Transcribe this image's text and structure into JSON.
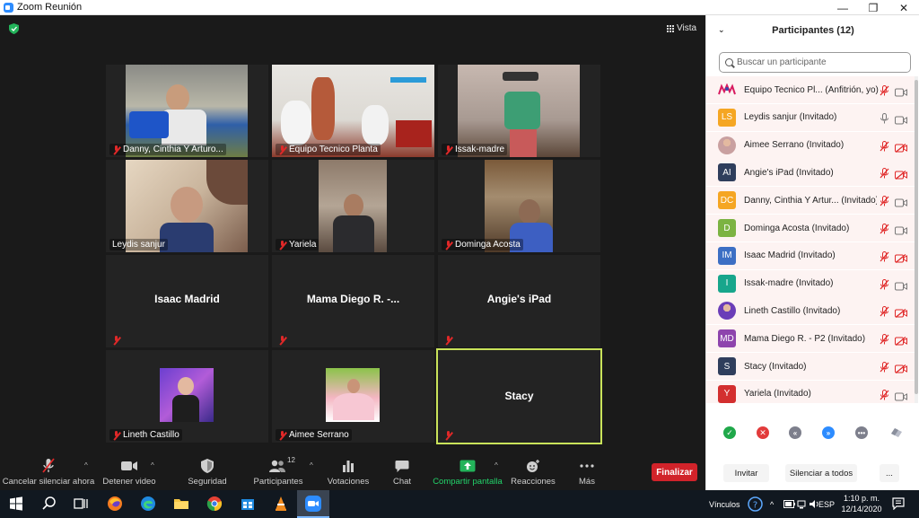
{
  "window": {
    "title": "Zoom Reunión",
    "minimize": "—",
    "maximize": "❐",
    "close": "✕"
  },
  "meeting": {
    "view_label": "Vista",
    "tiles": [
      {
        "name": "Danny, Cinthia Y Arturo...",
        "muted": true,
        "video": true
      },
      {
        "name": "Equipo Tecnico Planta",
        "muted": true,
        "video": true
      },
      {
        "name": "Issak-madre",
        "muted": true,
        "video": true
      },
      {
        "name": "Leydis sanjur",
        "muted": false,
        "video": true
      },
      {
        "name": "Yariela",
        "muted": true,
        "video": true
      },
      {
        "name": "Dominga Acosta",
        "muted": true,
        "video": true
      },
      {
        "name": "Isaac Madrid",
        "muted": true,
        "video": false
      },
      {
        "name": "Mama Diego R. -...",
        "muted": true,
        "video": false
      },
      {
        "name": "Angie's iPad",
        "muted": true,
        "video": false
      },
      {
        "name": "Lineth Castillo",
        "muted": true,
        "video": true
      },
      {
        "name": "Aimee Serrano",
        "muted": true,
        "video": true
      },
      {
        "name": "Stacy",
        "muted": true,
        "video": false,
        "active_speaker": true
      }
    ]
  },
  "toolbar": {
    "unmute": "Cancelar silenciar ahora",
    "stop_video": "Detener video",
    "security": "Seguridad",
    "participants": "Participantes",
    "participants_count": "12",
    "polls": "Votaciones",
    "chat": "Chat",
    "share": "Compartir pantalla",
    "reactions": "Reacciones",
    "more": "Más",
    "end": "Finalizar"
  },
  "panel": {
    "title": "Participantes (12)",
    "search_placeholder": "Buscar un participante",
    "participants": [
      {
        "initials": "",
        "name": "Equipo Tecnico Pl... (Anfitrión, yo)",
        "color": "#ffffff",
        "mic": "muted",
        "cam": "on",
        "photo": "logo"
      },
      {
        "initials": "LS",
        "name": "Leydis sanjur (Invitado)",
        "color": "#f5a623",
        "mic": "on",
        "cam": "on"
      },
      {
        "initials": "",
        "name": "Aimee Serrano (Invitado)",
        "color": "#c9a0a0",
        "mic": "muted",
        "cam": "off",
        "photo": "photo"
      },
      {
        "initials": "AI",
        "name": "Angie's iPad (Invitado)",
        "color": "#2f3e5c",
        "mic": "muted",
        "cam": "off"
      },
      {
        "initials": "DC",
        "name": "Danny, Cinthia Y Artur... (Invitado)",
        "color": "#f5a623",
        "mic": "muted",
        "cam": "on"
      },
      {
        "initials": "D",
        "name": "Dominga Acosta (Invitado)",
        "color": "#7cb342",
        "mic": "muted",
        "cam": "on"
      },
      {
        "initials": "IM",
        "name": "Isaac Madrid (Invitado)",
        "color": "#3c6fc4",
        "mic": "muted",
        "cam": "off"
      },
      {
        "initials": "I",
        "name": "Issak-madre (Invitado)",
        "color": "#17a68c",
        "mic": "muted",
        "cam": "on"
      },
      {
        "initials": "",
        "name": "Lineth Castillo (Invitado)",
        "color": "#6a3db8",
        "mic": "muted",
        "cam": "off",
        "photo": "photo"
      },
      {
        "initials": "MD",
        "name": "Mama Diego R. - P2 (Invitado)",
        "color": "#8e44ad",
        "mic": "muted",
        "cam": "off"
      },
      {
        "initials": "S",
        "name": "Stacy (Invitado)",
        "color": "#2f3e5c",
        "mic": "muted",
        "cam": "off"
      },
      {
        "initials": "Y",
        "name": "Yariela (Invitado)",
        "color": "#d32f2f",
        "mic": "muted",
        "cam": "on"
      }
    ],
    "reaction_icons": [
      "check-icon",
      "x-icon",
      "slower-icon",
      "faster-icon",
      "more-icon",
      "eraser-icon"
    ],
    "invite": "Invitar",
    "mute_all": "Silenciar a todos",
    "more": "..."
  },
  "taskbar": {
    "links": "Vínculos",
    "lang": "ESP",
    "time": "1:10 p. m.",
    "date": "12/14/2020"
  }
}
